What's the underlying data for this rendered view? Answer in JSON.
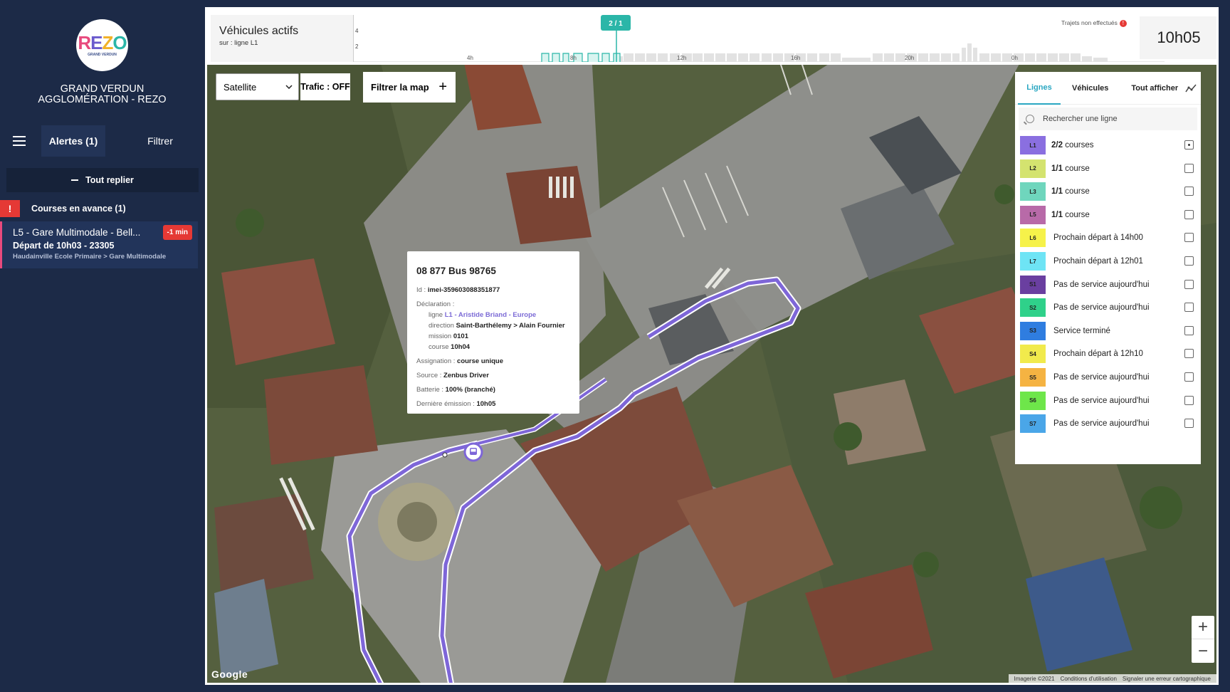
{
  "sidebar": {
    "logo_text": "REZO",
    "logo_sub": "GRAND VERDUN",
    "org_line1": "GRAND VERDUN",
    "org_line2": "AGGLOMÉRATION - REZO",
    "tab_alerts": "Alertes (1)",
    "tab_filter": "Filtrer",
    "collapse_all": "Tout replier",
    "alert_group": "Courses en avance (1)",
    "alert": {
      "title": "L5 - Gare Multimodale - Bell...",
      "delay": "-1 min",
      "departure": "Départ de 10h03 - 23305",
      "route": "Haudainville Ecole Primaire > Gare Multimodale"
    }
  },
  "activity": {
    "title": "Véhicules actifs",
    "subtitle": "sur : ligne L1",
    "marker": "2 / 1",
    "y_ticks": [
      "4",
      "2"
    ],
    "x_ticks": [
      "4h",
      "8h",
      "12h",
      "16h",
      "20h",
      "0h"
    ],
    "unrealized": "Trajets non effectués",
    "time": "10h05"
  },
  "map_controls": {
    "map_type": "Satellite",
    "traffic": "Trafic : OFF",
    "filter_map": "Filtrer la map"
  },
  "popup": {
    "title": "08 877 Bus 98765",
    "id_label": "Id :",
    "id_value": "imei-359603088351877",
    "declaration_label": "Déclaration :",
    "ligne_label": "ligne",
    "ligne_value": "L1 - Aristide Briand - Europe",
    "direction_label": "direction",
    "direction_value": "Saint-Barthélemy > Alain Fournier",
    "mission_label": "mission",
    "mission_value": "0101",
    "course_label": "course",
    "course_value": "10h04",
    "assignation_label": "Assignation :",
    "assignation_value": "course unique",
    "source_label": "Source :",
    "source_value": "Zenbus Driver",
    "battery_label": "Batterie :",
    "battery_value": "100% (branché)",
    "last_emission_label": "Dernière émission :",
    "last_emission_value": "10h05"
  },
  "lines_panel": {
    "tab_lines": "Lignes",
    "tab_vehicles": "Véhicules",
    "show_all": "Tout afficher",
    "search_placeholder": "Rechercher une ligne",
    "lines": [
      {
        "code": "L1",
        "color": "#8a6fe0",
        "count": "2/2",
        "text": "courses",
        "checked": true
      },
      {
        "code": "L2",
        "color": "#d4e36f",
        "count": "1/1",
        "text": "course",
        "checked": false
      },
      {
        "code": "L3",
        "color": "#6fd6bd",
        "count": "1/1",
        "text": "course",
        "checked": false
      },
      {
        "code": "L5",
        "color": "#b86aa8",
        "count": "1/1",
        "text": "course",
        "checked": false
      },
      {
        "code": "L6",
        "color": "#f6f24a",
        "count": "",
        "text": "Prochain départ à 14h00",
        "checked": false
      },
      {
        "code": "L7",
        "color": "#6ee4f5",
        "count": "",
        "text": "Prochain départ à 12h01",
        "checked": false
      },
      {
        "code": "S1",
        "color": "#6a3fa0",
        "count": "",
        "text": "Pas de service aujourd'hui",
        "checked": false
      },
      {
        "code": "S2",
        "color": "#2fd18a",
        "count": "",
        "text": "Pas de service aujourd'hui",
        "checked": false
      },
      {
        "code": "S3",
        "color": "#2f7de0",
        "count": "",
        "text": "Service terminé",
        "checked": false
      },
      {
        "code": "S4",
        "color": "#f1ea4c",
        "count": "",
        "text": "Prochain départ à 12h10",
        "checked": false
      },
      {
        "code": "S5",
        "color": "#f5b342",
        "count": "",
        "text": "Pas de service aujourd'hui",
        "checked": false
      },
      {
        "code": "S6",
        "color": "#6ee64a",
        "count": "",
        "text": "Pas de service aujourd'hui",
        "checked": false
      },
      {
        "code": "S7",
        "color": "#4aa6e8",
        "count": "",
        "text": "Pas de service aujourd'hui",
        "checked": false
      }
    ]
  },
  "zoom": {
    "in": "+",
    "out": "−"
  },
  "footer": {
    "google": "Google",
    "imagery": "Imagerie ©2021",
    "terms": "Conditions d'utilisation",
    "report": "Signaler une erreur cartographique"
  }
}
